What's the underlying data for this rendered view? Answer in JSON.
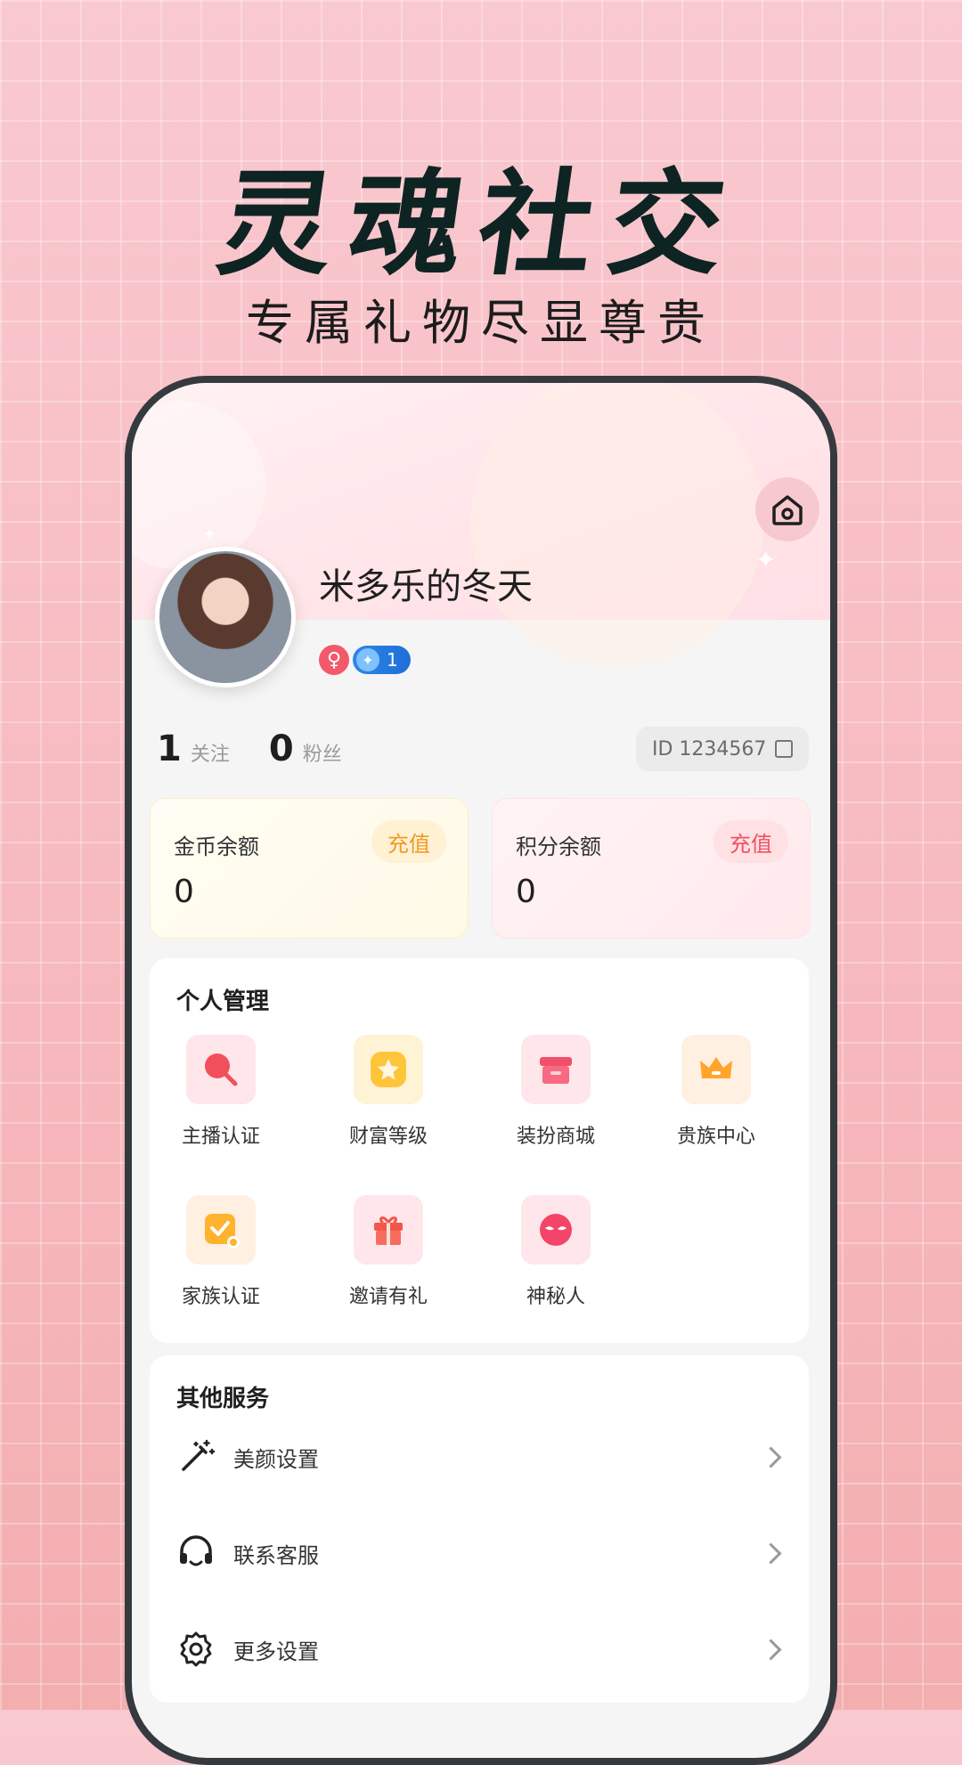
{
  "promo": {
    "headline": "灵魂社交",
    "subline": "专属礼物尽显尊贵"
  },
  "profile": {
    "username": "米多乐的冬天",
    "level_badge": "1",
    "follow_count": "1",
    "follow_label": "关注",
    "fans_count": "0",
    "fans_label": "粉丝",
    "id_text": "ID 1234567"
  },
  "wallet": {
    "gold": {
      "label": "金币余额",
      "value": "0",
      "button": "充值"
    },
    "points": {
      "label": "积分余额",
      "value": "0",
      "button": "充值"
    }
  },
  "management": {
    "title": "个人管理",
    "items": [
      {
        "label": "主播认证",
        "icon": "microphone-icon"
      },
      {
        "label": "财富等级",
        "icon": "star-icon"
      },
      {
        "label": "装扮商城",
        "icon": "shop-icon"
      },
      {
        "label": "贵族中心",
        "icon": "crown-icon"
      },
      {
        "label": "家族认证",
        "icon": "verified-badge-icon"
      },
      {
        "label": "邀请有礼",
        "icon": "gift-icon"
      },
      {
        "label": "神秘人",
        "icon": "mask-icon"
      }
    ]
  },
  "other_services": {
    "title": "其他服务",
    "items": [
      {
        "label": "美颜设置",
        "icon": "magic-wand-icon"
      },
      {
        "label": "联系客服",
        "icon": "headset-icon"
      },
      {
        "label": "更多设置",
        "icon": "gear-icon"
      }
    ]
  },
  "colors": {
    "accent_red": "#f25160",
    "accent_orange": "#f29a25",
    "level_blue": "#1e6fd6"
  }
}
